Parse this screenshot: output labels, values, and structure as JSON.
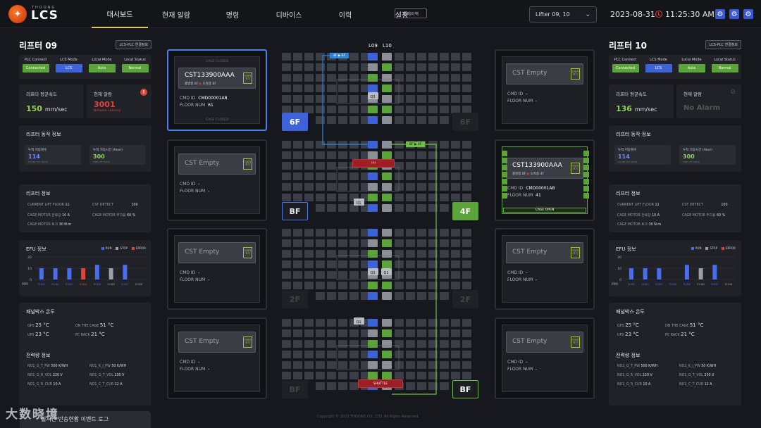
{
  "header": {
    "logo_sub": "THOONG",
    "logo": "LCS",
    "nav": [
      "대시보드",
      "현재 알람",
      "명령",
      "디바이스",
      "이력",
      "설정"
    ],
    "replay": "플레이백",
    "lifter_select": "Lifter 09, 10",
    "date": "2023-08-31",
    "time": "11:25:30 AM"
  },
  "left": {
    "title": "리프터 09",
    "badge": "LCS-PLC 연결정보",
    "status": [
      {
        "label": "PLC Connect",
        "value": "Connected",
        "color": "green"
      },
      {
        "label": "LCS Mode",
        "value": "LCS",
        "color": "blue"
      },
      {
        "label": "Local Mode",
        "value": "Auto",
        "color": "green"
      },
      {
        "label": "Local Status",
        "value": "Normal",
        "color": "green"
      }
    ],
    "speed_label": "리프터 평균속도",
    "speed": "150",
    "speed_unit": "mm/sec",
    "alarm_label": "현재 알람",
    "alarm_code": "3001",
    "alarm_desc": "Network Latency",
    "op_title": "리프터 동작 정보",
    "move_label": "누적 이동횟수",
    "move_val": "114",
    "move_sub": "COUNT LIFT MOVE",
    "time_label": "누적 가동시간 (Hour)",
    "time_val": "300",
    "time_sub": "TIME LIFT MOVE",
    "info_title": "리프터 정보",
    "info": [
      [
        "CURRENT LIFT FLOOR",
        "11",
        "CST DETECT",
        "100"
      ],
      [
        "CAGE MOTOR 전류값",
        "10 A",
        "CAGE MOTOR 부하율",
        "60 %"
      ],
      [
        "CAGE MOTOR 토크",
        "30 N·m",
        "",
        ""
      ]
    ],
    "efu_title": "EFU 정보",
    "temp_title": "패널박스 온도",
    "temps": [
      [
        "GPS",
        "25 °C",
        "ON THE CAGE",
        "51 °C"
      ],
      [
        "UPS",
        "23 °C",
        "PC RACK",
        "21 °C"
      ]
    ],
    "power_title": "전력량 정보",
    "power": [
      [
        "NO1_G_T_PW",
        "500 K/WH",
        "NO1_K_I_PW",
        "50 K/WH"
      ],
      [
        "NO1_G_R_VOL",
        "220 V",
        "NO1_G_T_VOL",
        "230 V"
      ],
      [
        "NO1_G_R_CUR",
        "10 A",
        "NO1_C_T_CUR",
        "12 A"
      ]
    ]
  },
  "right": {
    "title": "리프터 10",
    "badge": "LCS-PLC 연결정보",
    "status": [
      {
        "label": "PLC Connect",
        "value": "Connected",
        "color": "green"
      },
      {
        "label": "LCS Mode",
        "value": "LCS",
        "color": "blue"
      },
      {
        "label": "Local Mode",
        "value": "Auto",
        "color": "green"
      },
      {
        "label": "Local Status",
        "value": "Normal",
        "color": "green"
      }
    ],
    "speed_label": "리프터 평균속도",
    "speed": "136",
    "speed_unit": "mm/sec",
    "alarm_label": "현재 알람",
    "alarm_text": "No Alarm",
    "op_title": "리프터 동작 정보",
    "move_label": "누적 이동횟수",
    "move_val": "114",
    "move_sub": "COUNT LIFT MOVE",
    "time_label": "누적 가동시간 (Hour)",
    "time_val": "300",
    "time_sub": "TIME LIFT MOVE",
    "info_title": "리프터 정보",
    "info": [
      [
        "CURRENT LIFT FLOOR",
        "11",
        "CST DETECT",
        "100"
      ],
      [
        "CAGE MOTOR 전류값",
        "10 A",
        "CAGE MOTOR 부하율",
        "60 %"
      ],
      [
        "CAGE MOTOR 토크",
        "30 N·m",
        "",
        ""
      ]
    ],
    "efu_title": "EFU 정보",
    "temp_title": "패널박스 온도",
    "temps": [
      [
        "GPS",
        "25 °C",
        "ON THE CAGE",
        "51 °C"
      ],
      [
        "UPS",
        "23 °C",
        "PC RACK",
        "21 °C"
      ]
    ],
    "power_title": "전력량 정보",
    "power": [
      [
        "NO1_G_T_PW",
        "500 K/WH",
        "NO1_K_I_PW",
        "50 K/WH"
      ],
      [
        "NO1_G_R_VOL",
        "220 V",
        "NO1_G_T_VOL",
        "230 V"
      ],
      [
        "NO1_G_R_CUR",
        "10 A",
        "NO1_C_T_CUR",
        "12 A"
      ]
    ]
  },
  "efu_legend": [
    "RUN",
    "STOP",
    "ERROR"
  ],
  "chart_data": [
    {
      "type": "bar",
      "categories": [
        "EUN1",
        "EUN2",
        "EUN3",
        "EUN4",
        "EUN5",
        "EUN6",
        "EUN7",
        "EUN8"
      ],
      "values": [
        10,
        10,
        10,
        10,
        13,
        10,
        13,
        0
      ],
      "colors": [
        "#4a6cf0",
        "#4a6cf0",
        "#4a6cf0",
        "#e0443a",
        "#4a6cf0",
        "#9aa0aa",
        "#4a6cf0",
        "#9aa0aa"
      ],
      "ylim": [
        0,
        20
      ],
      "yticks": [
        0,
        10,
        20
      ],
      "ylabel": "RPM"
    },
    {
      "type": "bar",
      "categories": [
        "EUN1",
        "EUN2",
        "EUN3",
        "EUN4",
        "EUN5",
        "EUN6",
        "EUN7",
        "EUN8"
      ],
      "values": [
        10,
        10,
        10,
        0,
        13,
        10,
        13,
        0
      ],
      "colors": [
        "#4a6cf0",
        "#4a6cf0",
        "#4a6cf0",
        "#4a6cf0",
        "#4a6cf0",
        "#9aa0aa",
        "#4a6cf0",
        "#9aa0aa"
      ],
      "ylim": [
        0,
        20
      ],
      "yticks": [
        0,
        10,
        20
      ],
      "ylabel": "RPM"
    }
  ],
  "bays": {
    "left": [
      {
        "cst": "CST133900AAA",
        "full": true,
        "flow_from": "출발층 6F",
        "flow_to": "도착층 6F",
        "cmd_id": "CMD00001AB",
        "floor_num": "61",
        "tag": "자세히 보기",
        "cage_top": "CAGE CLOSED",
        "cage_bottom": "CAGE CLOSED"
      },
      {
        "cst": "CST Empty",
        "full": false,
        "cmd_id": "-",
        "floor_num": "-",
        "tag": "자세히 보기"
      },
      {
        "cst": "CST Empty",
        "full": false,
        "cmd_id": "-",
        "floor_num": "-",
        "tag": "자세히 보기"
      },
      {
        "cst": "CST Empty",
        "full": false,
        "cmd_id": "-",
        "floor_num": "-",
        "tag": "자세히 보기"
      }
    ],
    "right": [
      {
        "cst": "CST Empty",
        "full": false,
        "cmd_id": "-",
        "floor_num": "-",
        "tag": "자세히 보기"
      },
      {
        "cst": "CST133900AAA",
        "full": true,
        "flow_from": "출발층 BF",
        "flow_to": "도착층 4F",
        "cmd_id": "CMD00001AB",
        "floor_num": "41",
        "tag": "자세히 보기",
        "cage_bottom": "CAGE OPEN"
      },
      {
        "cst": "CST Empty",
        "full": false,
        "cmd_id": "-",
        "floor_num": "-",
        "tag": "자세히 보기"
      },
      {
        "cst": "CST Empty",
        "full": false,
        "cmd_id": "-",
        "floor_num": "-",
        "tag": "자세히 보기"
      }
    ],
    "labels": {
      "cmd": "CMD ID",
      "floor": "FLOOR NUM"
    }
  },
  "floors": {
    "left": [
      "6F",
      "BF",
      "2F",
      "BF"
    ],
    "right": [
      "6F",
      "4F",
      "2F",
      "BF"
    ]
  },
  "lifts": {
    "l09": "L09",
    "l10": "L10",
    "tag1": "4F ▶ 6F",
    "tag2": "BF ▶ 4F",
    "shuttle": "SHUTTLE",
    "alert": "!!!!"
  },
  "slots": [
    "Q3",
    "Q1",
    "Q3",
    "Q1",
    "Q1"
  ],
  "footer": {
    "copyright": "Copyright © 2023 THOONG CO., LTD. All Rights Reserved.",
    "event_log": "실시간 반송현황 이벤트 로그",
    "watermark": "大数晓境"
  }
}
